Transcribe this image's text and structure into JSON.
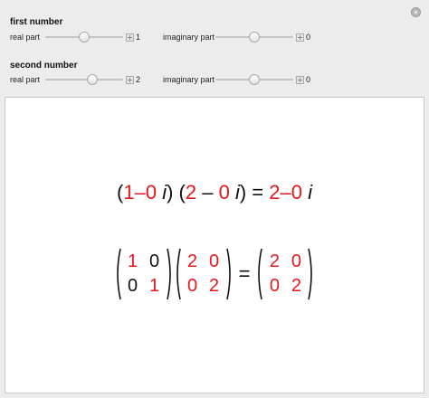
{
  "corner_icon": "plus-circle-icon",
  "controls": {
    "first": {
      "title": "first number",
      "real": {
        "label": "real part",
        "value": "1",
        "position": 0.5
      },
      "imag": {
        "label": "imaginary part",
        "value": "0",
        "position": 0.5
      }
    },
    "second": {
      "title": "second number",
      "real": {
        "label": "real part",
        "value": "2",
        "position": 0.6
      },
      "imag": {
        "label": "imaginary part",
        "value": "0",
        "position": 0.5
      }
    }
  },
  "output": {
    "expr": {
      "open1": "(",
      "a_re": "1",
      "a_op": "–",
      "a_im": "0",
      "i1": " i",
      "close1": ")",
      "open2": " (",
      "b_re": "2",
      "b_op": " – ",
      "b_im": "0",
      "i2": " i",
      "close2": ")",
      "equals": " = ",
      "r_re": "2",
      "r_op": "–",
      "r_im": "0",
      "i3": " i"
    },
    "matrix_a": [
      "1",
      "0",
      "0",
      "1"
    ],
    "matrix_b": [
      "2",
      "0",
      "0",
      "2"
    ],
    "matrix_equals": "=",
    "matrix_c": [
      "2",
      "0",
      "0",
      "2"
    ]
  },
  "colors": {
    "accent_red": "#e8171b",
    "panel_bg": "#ececec",
    "output_bg": "#ffffff"
  }
}
